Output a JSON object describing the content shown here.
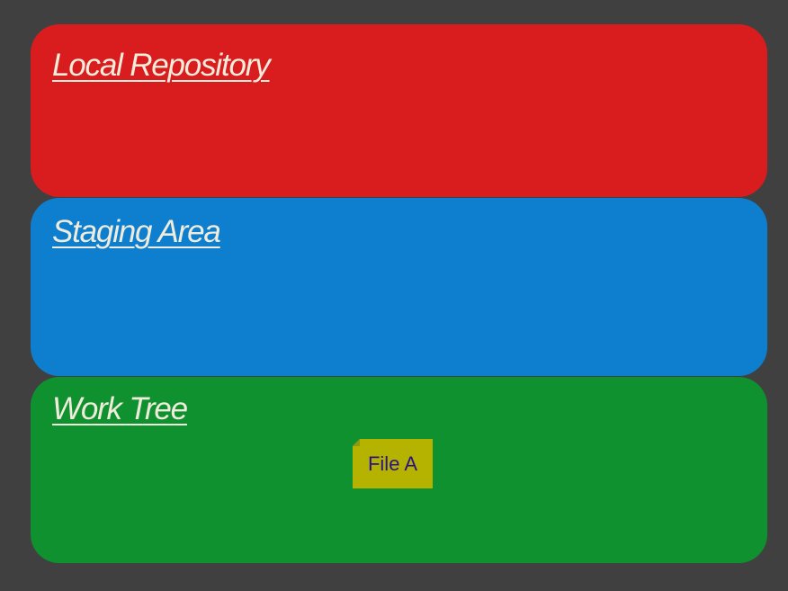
{
  "areas": {
    "local_repository": {
      "title": "Local Repository",
      "color": "#d91c1e"
    },
    "staging_area": {
      "title": "Staging Area",
      "color": "#0e7ecf"
    },
    "work_tree": {
      "title": "Work Tree",
      "color": "#10912f"
    }
  },
  "files": [
    {
      "label": "File A",
      "color": "#b5b300"
    }
  ]
}
